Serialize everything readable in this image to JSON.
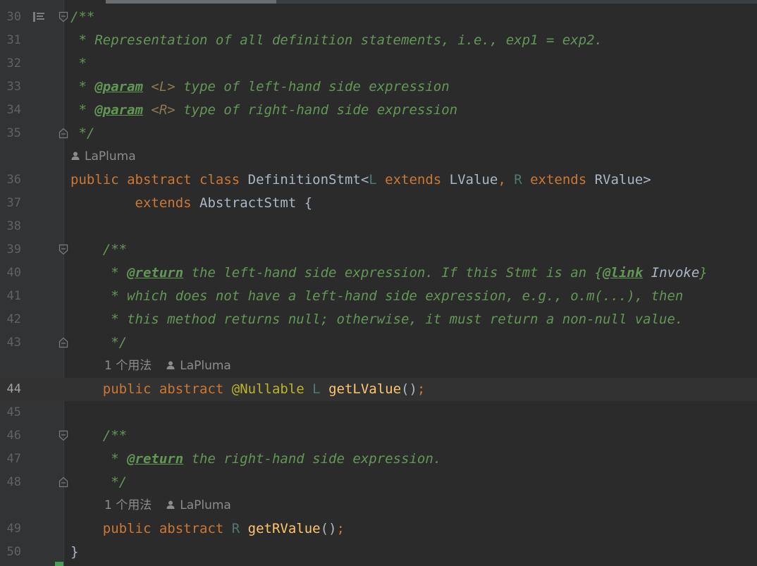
{
  "editor": {
    "lines": [
      {
        "num": "30",
        "fold": "start",
        "gutter_icon": "implementation-icon",
        "segs": [
          {
            "c": "cmt",
            "t": "/**"
          }
        ]
      },
      {
        "num": "31",
        "segs": [
          {
            "c": "cmt",
            "t": " * Representation of all definition statements, i.e., exp1 = exp2."
          }
        ]
      },
      {
        "num": "32",
        "segs": [
          {
            "c": "cmt",
            "t": " *"
          }
        ]
      },
      {
        "num": "33",
        "segs": [
          {
            "c": "cmt",
            "t": " * "
          },
          {
            "c": "tag",
            "t": "@param"
          },
          {
            "c": "cmt",
            "t": " "
          },
          {
            "c": "tparam",
            "t": "<L>"
          },
          {
            "c": "cmt",
            "t": " type of left-hand side expression"
          }
        ]
      },
      {
        "num": "34",
        "segs": [
          {
            "c": "cmt",
            "t": " * "
          },
          {
            "c": "tag",
            "t": "@param"
          },
          {
            "c": "cmt",
            "t": " "
          },
          {
            "c": "tparam",
            "t": "<R>"
          },
          {
            "c": "cmt",
            "t": " type of right-hand side expression"
          }
        ]
      },
      {
        "num": "35",
        "fold": "end",
        "segs": [
          {
            "c": "cmt",
            "t": " */"
          }
        ]
      },
      {
        "hint": true,
        "indent": 0,
        "author": "LaPluma"
      },
      {
        "num": "36",
        "segs": [
          {
            "c": "kw",
            "t": "public abstract class "
          },
          {
            "c": "plain",
            "t": "DefinitionStmt<"
          },
          {
            "c": "tp",
            "t": "L"
          },
          {
            "c": "kw",
            "t": " extends "
          },
          {
            "c": "plain",
            "t": "LValue"
          },
          {
            "c": "kw",
            "t": ", "
          },
          {
            "c": "tp",
            "t": "R"
          },
          {
            "c": "kw",
            "t": " extends "
          },
          {
            "c": "plain",
            "t": "RValue>"
          }
        ]
      },
      {
        "num": "37",
        "segs": [
          {
            "c": "kw",
            "t": "        extends "
          },
          {
            "c": "plain",
            "t": "AbstractStmt {"
          }
        ]
      },
      {
        "num": "38",
        "segs": []
      },
      {
        "num": "39",
        "fold": "start",
        "segs": [
          {
            "c": "cmt",
            "t": "    /**"
          }
        ]
      },
      {
        "num": "40",
        "segs": [
          {
            "c": "cmt",
            "t": "     * "
          },
          {
            "c": "tag",
            "t": "@return"
          },
          {
            "c": "cmt",
            "t": " the left-hand side expression. If this Stmt is an {"
          },
          {
            "c": "tag",
            "t": "@link"
          },
          {
            "c": "cmt",
            "t": " "
          },
          {
            "c": "linkref",
            "t": "Invoke"
          },
          {
            "c": "cmt",
            "t": "}"
          }
        ]
      },
      {
        "num": "41",
        "segs": [
          {
            "c": "cmt",
            "t": "     * which does not have a left-hand side expression, e.g., o.m(...), then"
          }
        ]
      },
      {
        "num": "42",
        "segs": [
          {
            "c": "cmt",
            "t": "     * this method returns null; otherwise, it must return a non-null value."
          }
        ]
      },
      {
        "num": "43",
        "fold": "end",
        "segs": [
          {
            "c": "cmt",
            "t": "     */"
          }
        ]
      },
      {
        "hint": true,
        "indent": 48,
        "usage": "1 个用法",
        "author": "LaPluma"
      },
      {
        "num": "44",
        "current": true,
        "segs": [
          {
            "c": "kw",
            "t": "    public abstract "
          },
          {
            "c": "ann",
            "t": "@Nullable "
          },
          {
            "c": "tp",
            "t": "L "
          },
          {
            "c": "mth",
            "t": "getLValue"
          },
          {
            "c": "plain",
            "t": "()"
          },
          {
            "c": "kw",
            "t": ";"
          }
        ]
      },
      {
        "num": "45",
        "segs": []
      },
      {
        "num": "46",
        "fold": "start",
        "segs": [
          {
            "c": "cmt",
            "t": "    /**"
          }
        ]
      },
      {
        "num": "47",
        "segs": [
          {
            "c": "cmt",
            "t": "     * "
          },
          {
            "c": "tag",
            "t": "@return"
          },
          {
            "c": "cmt",
            "t": " the right-hand side expression."
          }
        ]
      },
      {
        "num": "48",
        "fold": "end",
        "segs": [
          {
            "c": "cmt",
            "t": "     */"
          }
        ]
      },
      {
        "hint": true,
        "indent": 48,
        "usage": "1 个用法",
        "author": "LaPluma"
      },
      {
        "num": "49",
        "segs": [
          {
            "c": "kw",
            "t": "    public abstract "
          },
          {
            "c": "tp",
            "t": "R "
          },
          {
            "c": "mth",
            "t": "getRValue"
          },
          {
            "c": "plain",
            "t": "()"
          },
          {
            "c": "kw",
            "t": ";"
          }
        ]
      },
      {
        "num": "50",
        "segs": [
          {
            "c": "plain",
            "t": "}"
          }
        ]
      }
    ]
  },
  "colors": {
    "background": "#2b2b2b",
    "gutter": "#313335",
    "comment": "#629755",
    "keyword": "#cc7832",
    "type_param": "#507874",
    "annotation": "#bbb529",
    "method": "#ffc66d",
    "plain": "#a9b7c6",
    "inlay_hint": "#8c8c8c",
    "current_line": "#323232"
  }
}
